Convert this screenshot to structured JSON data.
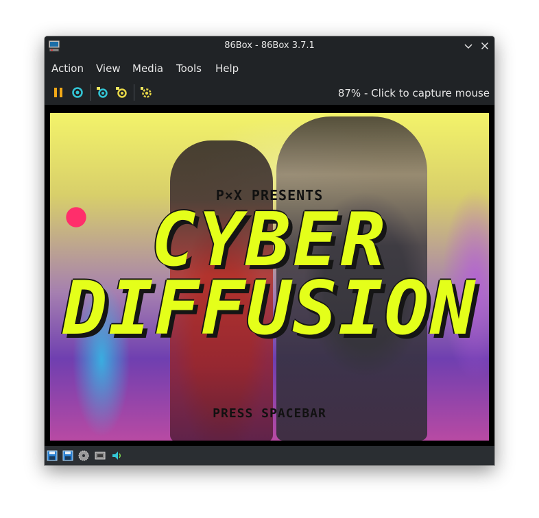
{
  "window": {
    "title": "86Box - 86Box 3.7.1"
  },
  "menubar": {
    "items": [
      "Action",
      "View",
      "Media",
      "Tools",
      "Help"
    ]
  },
  "toolbar": {
    "buttons": [
      "pause-icon",
      "ctrl-alt-del-icon",
      "hard-reset-icon",
      "settings-icon-a",
      "settings-icon-b"
    ],
    "status": "87% - Click to capture mouse"
  },
  "screen": {
    "presents": "P×X PRESENTS",
    "title_line1": "CYBER",
    "title_line2": "DIFFUSION",
    "prompt": "PRESS SPACEBAR"
  },
  "statusbar": {
    "icons": [
      "floppy-a-icon",
      "floppy-b-icon",
      "cdrom-icon",
      "network-icon",
      "sound-icon"
    ]
  },
  "colors": {
    "title_fill": "#e4ff1a",
    "chrome": "#202326",
    "accent_pause": "#f0a818",
    "accent_cyan": "#33c6d6"
  }
}
